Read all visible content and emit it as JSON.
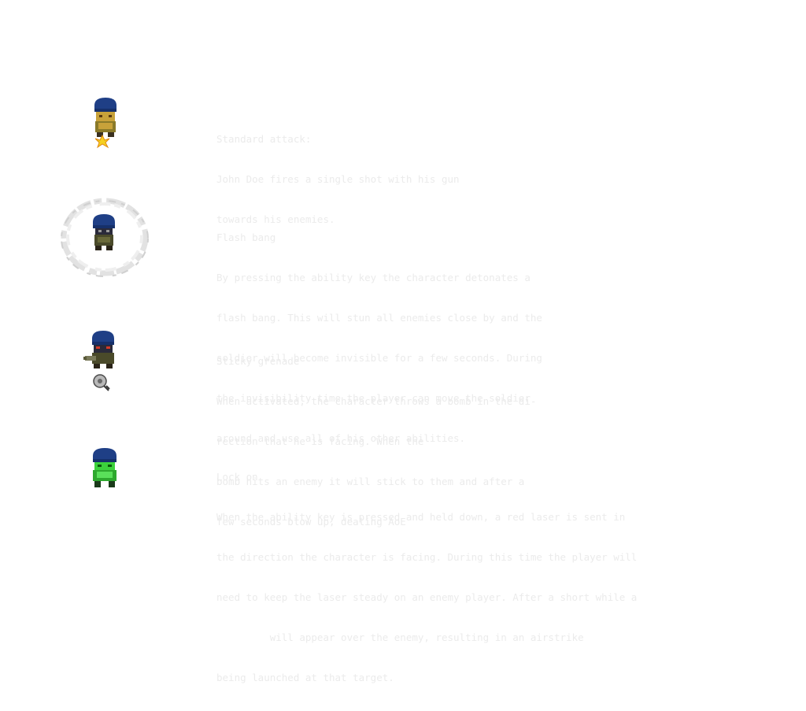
{
  "abilities": [
    {
      "id": "standard-attack",
      "sprite": "soldier-firing-sprite",
      "title": "Standard attack:",
      "lines": [
        "John Doe fires a single shot with his gun",
        "towards his enemies."
      ]
    },
    {
      "id": "flash-bang",
      "sprite": "soldier-smoke-ring-sprite",
      "title": "Flash bang",
      "lines": [
        "By pressing the ability key the character detonates a",
        "flash bang. This will stun all enemies close by and the",
        "soldier will become invisible for a few seconds. During",
        "the invisibility time the player can move the soldier",
        "around and use all of his other abilities."
      ]
    },
    {
      "id": "sticky-grenade",
      "sprite": "soldier-grenade-sprite",
      "title": "Sticky grenade",
      "lines": [
        "When activated, the character throws a bomb in the di-",
        "rection that he is facing. When the",
        "bomb hits an enemy it will stick to them and after a",
        "few seconds blow up, dealing AoE"
      ]
    },
    {
      "id": "lock-on",
      "sprite": "soldier-laser-sprite",
      "title": "Lock on",
      "lines": [
        "When the ability key is pressed and held down, a red laser is sent in",
        "the direction the character is facing. During this time the player will",
        "need to keep the laser steady on an enemy player. After a short while a",
        "         will appear over the enemy, resulting in an airstrike",
        "being launched at that target."
      ]
    }
  ],
  "colors": {
    "background": "#ffffff",
    "text": "#ebebeb",
    "helmet": "#1f3f86",
    "skin": "#c8a23a",
    "uniform": "#4a4a2a",
    "muzzle_flash": "#f5d020",
    "smoke": "#d8d8d8",
    "grenade": "#8a8a8a",
    "laser_glow": "#3cd23c"
  }
}
